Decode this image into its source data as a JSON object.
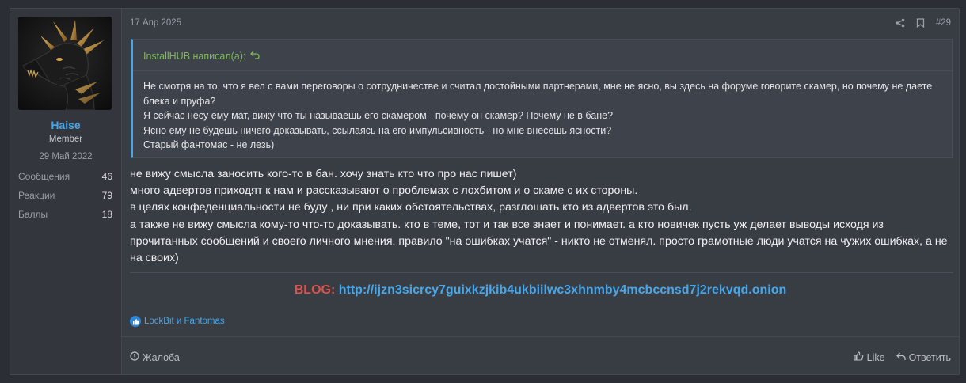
{
  "author": {
    "username": "Haise",
    "title": "Member",
    "joined": "29 Май 2022",
    "stats": [
      {
        "label": "Сообщения",
        "value": "46"
      },
      {
        "label": "Реакции",
        "value": "79"
      },
      {
        "label": "Баллы",
        "value": "18"
      }
    ]
  },
  "post": {
    "date": "17 Апр 2025",
    "number": "#29",
    "header_icons": [
      "share-icon",
      "bookmark-icon"
    ],
    "quote": {
      "author_line": "InstallHUB написал(а):",
      "lines": [
        "Не смотря на то, что я вел с вами переговоры о сотрудничестве и считал достойными партнерами, мне не ясно, вы здесь на форуме говорите скамер, но почему не даете блека и пруфа?",
        "Я сейчас несу ему мат, вижу что ты называешь его скамером - почему он скамер? Почему не в бане?",
        "Ясно ему не будешь ничего доказывать, ссылаясь на его импульсивность - но мне внесешь ясности?",
        "Старый фантомас - не лезь)"
      ]
    },
    "message_lines": [
      "не вижу смысла заносить кого-то в бан. хочу знать кто что про нас пишет)",
      "много адвертов приходят к нам и рассказывают о проблемах с лохбитом и о скаме с их стороны.",
      "в целях конфеденциальности не буду , ни при каких обстоятельствах, разглошать кто из адвертов это был.",
      "а также не вижу смысла кому-то что-то доказывать. кто в теме, тот и так все знает и понимает. а кто новичек пусть уж делает выводы исходя из прочитанных сообщений и своего личного мнения. правило \"на ошибках учатся\" - никто не отменял. просто грамотные люди учатся на чужих ошибках, а не на своих)"
    ],
    "signature": {
      "label": "BLOG:",
      "link": "http://ijzn3sicrcy7guixkzjkib4ukbiilwc3xhnmby4mcbccnsd7j2rekvqd.onion"
    },
    "reactions_text": "LockBit и Fantomas"
  },
  "footer": {
    "report": "Жалоба",
    "like": "Like",
    "reply": "Ответить"
  },
  "colors": {
    "accent": "#47a7eb",
    "quote_author": "#7fb85a",
    "blog_label": "#d9534f"
  }
}
